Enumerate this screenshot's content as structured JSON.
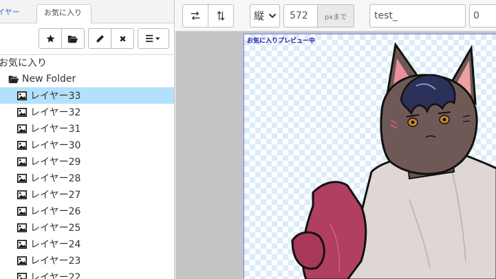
{
  "tabs": [
    {
      "label": "イヤー"
    },
    {
      "label": "お気に入り"
    }
  ],
  "toolbar": {
    "icons": [
      "star-icon",
      "folder-open-icon",
      "pencil-icon",
      "close-icon",
      "menu-icon"
    ]
  },
  "tree": {
    "root_label": "お気に入り",
    "folder_label": "New Folder",
    "layers": [
      "レイヤー33",
      "レイヤー32",
      "レイヤー31",
      "レイヤー30",
      "レイヤー29",
      "レイヤー28",
      "レイヤー27",
      "レイヤー26",
      "レイヤー25",
      "レイヤー24",
      "レイヤー23",
      "レイヤー22"
    ],
    "selected": "レイヤー33"
  },
  "controls": {
    "direction_value": "縦",
    "size_value": "572",
    "size_unit": "pxまで",
    "name_value": "test_",
    "number_value": "0"
  },
  "preview": {
    "label": "お気に入りプレビュー中"
  },
  "colors": {
    "selected_row": "#b3e1fb",
    "preview_label": "#1a1aa0",
    "checker": "#dcecf9"
  }
}
